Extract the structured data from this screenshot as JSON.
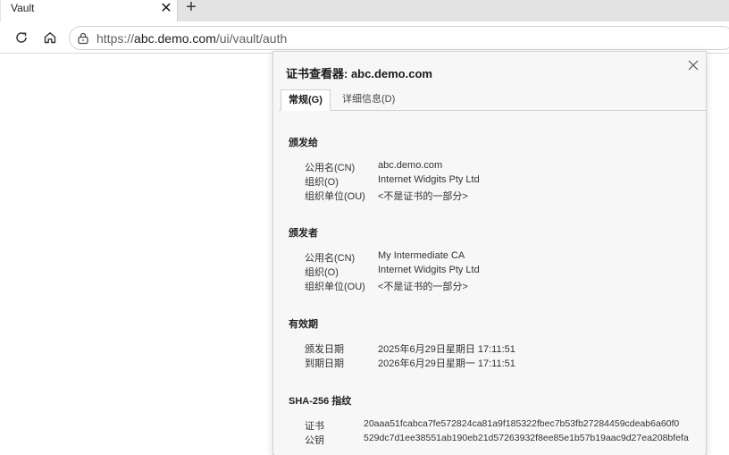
{
  "browser": {
    "tab": {
      "title": "Vault",
      "close_glyph": "✕"
    },
    "new_tab_glyph": "+",
    "toolbar": {
      "reload_icon": "reload-icon",
      "home_icon": "home-icon",
      "address": {
        "scheme": "https://",
        "host": "abc.demo.com",
        "path": "/ui/vault/auth"
      }
    }
  },
  "dialog": {
    "title": "证书查看器: abc.demo.com",
    "close_glyph": "✕",
    "tabs": [
      {
        "label": "常规(G)",
        "active": true
      },
      {
        "label": "详细信息(D)",
        "active": false
      }
    ],
    "issued_to": {
      "title": "颁发给",
      "rows": [
        {
          "label": "公用名(CN)",
          "value": "abc.demo.com"
        },
        {
          "label": "组织(O)",
          "value": "Internet Widgits Pty Ltd"
        },
        {
          "label": "组织单位(OU)",
          "value": "<不是证书的一部分>"
        }
      ]
    },
    "issued_by": {
      "title": "颁发者",
      "rows": [
        {
          "label": "公用名(CN)",
          "value": "My Intermediate CA"
        },
        {
          "label": "组织(O)",
          "value": "Internet Widgits Pty Ltd"
        },
        {
          "label": "组织单位(OU)",
          "value": "<不是证书的一部分>"
        }
      ]
    },
    "validity": {
      "title": "有效期",
      "rows": [
        {
          "label": "颁发日期",
          "value": "2025年6月29日星期日 17:11:51"
        },
        {
          "label": "到期日期",
          "value": "2026年6月29日星期一 17:11:51"
        }
      ]
    },
    "fingerprints": {
      "title": "SHA-256 指纹",
      "rows": [
        {
          "label": "证书",
          "value": "20aaa51fcabca7fe572824ca81a9f185322fbec7b53fb27284459cdeab6a60f0"
        },
        {
          "label": "公钥",
          "value": "529dc7d1ee38551ab190eb21d57263932f8ee85e1b57b19aac9d27ea208bfefa"
        }
      ]
    }
  }
}
